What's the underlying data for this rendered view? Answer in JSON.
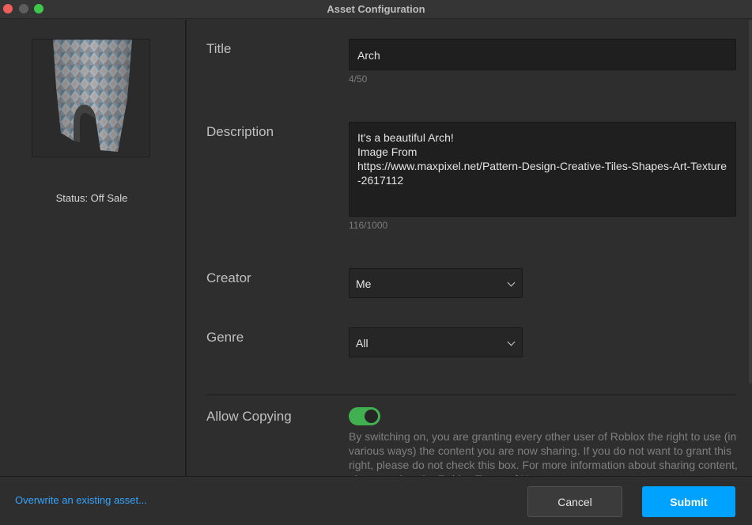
{
  "window": {
    "title": "Asset Configuration"
  },
  "sidebar": {
    "status": "Status: Off Sale"
  },
  "form": {
    "title": {
      "label": "Title",
      "value": "Arch",
      "counter": "4/50"
    },
    "description": {
      "label": "Description",
      "value": "It's a beautiful Arch!\nImage From\nhttps://www.maxpixel.net/Pattern-Design-Creative-Tiles-Shapes-Art-Texture-2617112",
      "counter": "116/1000"
    },
    "creator": {
      "label": "Creator",
      "selected": "Me"
    },
    "genre": {
      "label": "Genre",
      "selected": "All"
    },
    "allow_copying": {
      "label": "Allow Copying",
      "enabled": true,
      "help": "By switching on, you are granting every other user of Roblox the right to use (in various ways) the content you are now sharing. If you do not want to grant this right, please do not check this box. For more information about sharing content, please review the Roblox Terms of Use."
    }
  },
  "footer": {
    "overwrite_link": "Overwrite an existing asset...",
    "cancel_label": "Cancel",
    "submit_label": "Submit"
  },
  "colors": {
    "accent": "#00a2ff",
    "toggle_on": "#41b050",
    "link": "#35a4ff",
    "background": "#2e2e2e"
  }
}
